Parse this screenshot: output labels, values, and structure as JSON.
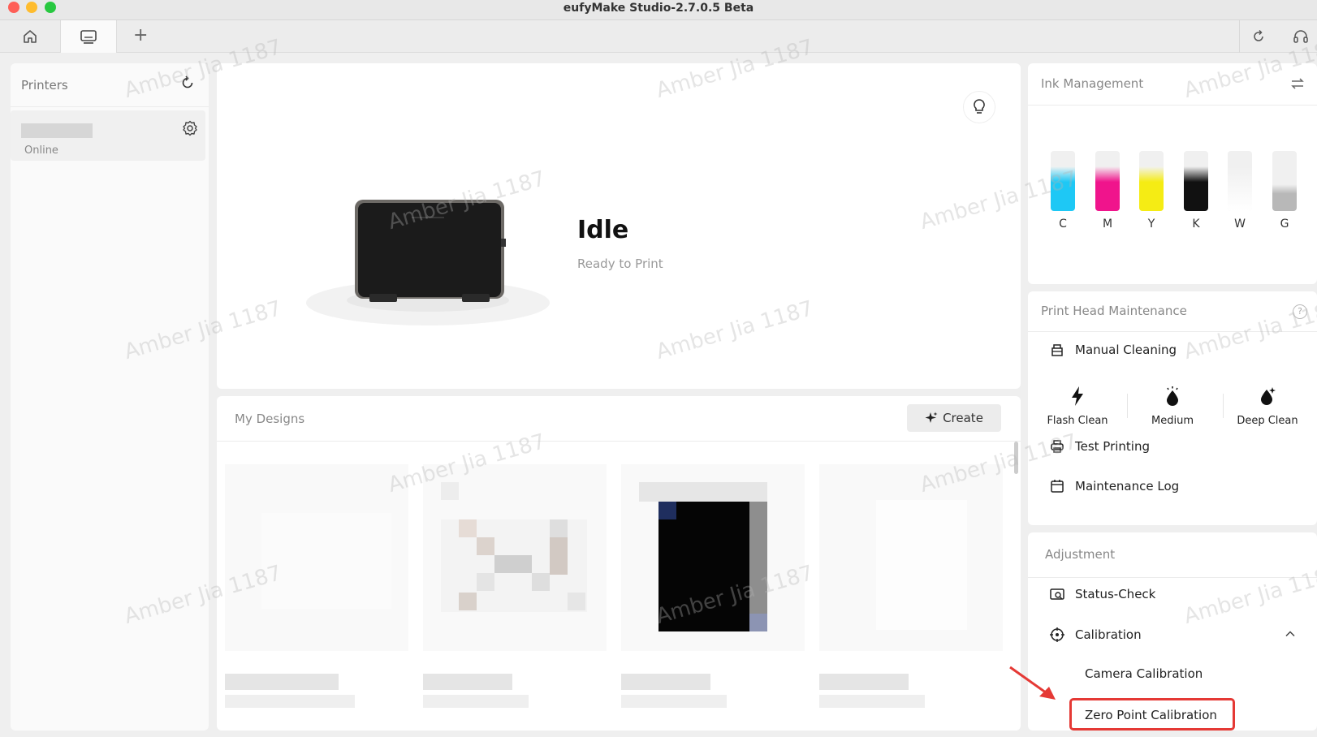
{
  "window": {
    "title": "eufyMake Studio-2.7.0.5 Beta"
  },
  "tabs": {
    "add_label": "+"
  },
  "printers": {
    "title": "Printers",
    "items": [
      {
        "status": "Online"
      }
    ]
  },
  "status": {
    "title": "Idle",
    "subtitle": "Ready to Print"
  },
  "designs": {
    "title": "My Designs",
    "create_label": "Create"
  },
  "ink": {
    "title": "Ink Management",
    "colors": [
      {
        "label": "C",
        "color": "#1ec8f5",
        "level": 0.75
      },
      {
        "label": "M",
        "color": "#f0148c",
        "level": 0.75
      },
      {
        "label": "Y",
        "color": "#f5ec14",
        "level": 0.75
      },
      {
        "label": "K",
        "color": "#111111",
        "level": 0.75
      },
      {
        "label": "W",
        "color": "#fbfbfb",
        "level": 0.75
      },
      {
        "label": "G",
        "color": "#b8b8b8",
        "level": 0.45
      }
    ]
  },
  "print_head": {
    "title": "Print Head Maintenance",
    "help": "?",
    "manual_cleaning": "Manual Cleaning",
    "clean_modes": [
      "Flash Clean",
      "Medium",
      "Deep Clean"
    ],
    "test_printing": "Test Printing",
    "maintenance_log": "Maintenance Log"
  },
  "adjustment": {
    "title": "Adjustment",
    "status_check": "Status-Check",
    "calibration": "Calibration",
    "camera_calibration": "Camera Calibration",
    "zero_point_calibration": "Zero Point Calibration"
  },
  "watermark": "Amber Jia 1187",
  "accent": {
    "highlight": "#e53935"
  }
}
